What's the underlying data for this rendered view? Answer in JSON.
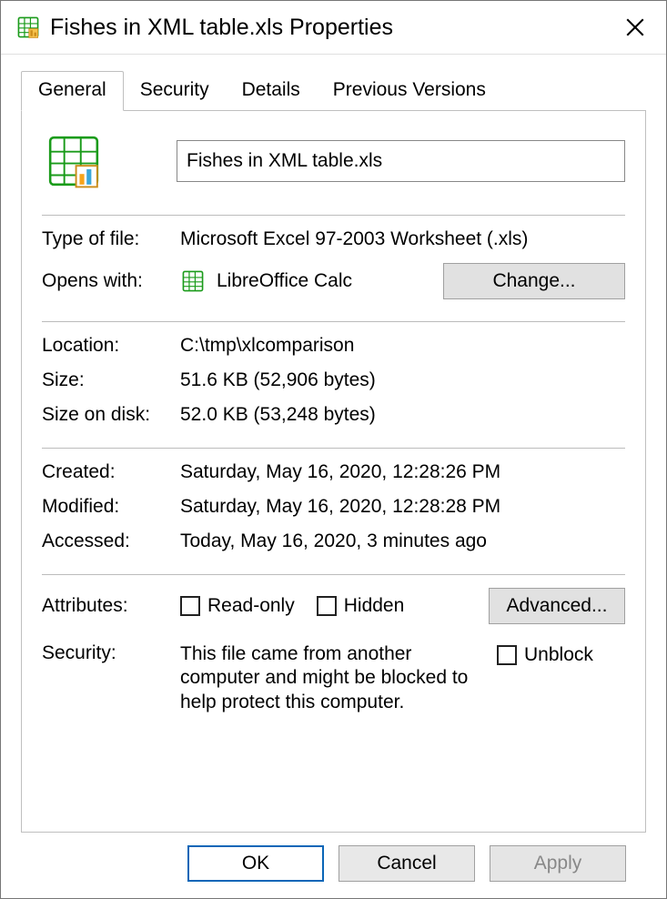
{
  "window": {
    "title": "Fishes in XML table.xls Properties"
  },
  "tabs": {
    "general": "General",
    "security": "Security",
    "details": "Details",
    "previous": "Previous Versions"
  },
  "general": {
    "filename": "Fishes in XML table.xls",
    "type_label": "Type of file:",
    "type_value": "Microsoft Excel 97-2003 Worksheet (.xls)",
    "opens_label": "Opens with:",
    "opens_value": "LibreOffice Calc",
    "change_button": "Change...",
    "location_label": "Location:",
    "location_value": "C:\\tmp\\xlcomparison",
    "size_label": "Size:",
    "size_value": "51.6 KB (52,906 bytes)",
    "size_on_disk_label": "Size on disk:",
    "size_on_disk_value": "52.0 KB (53,248 bytes)",
    "created_label": "Created:",
    "created_value": "Saturday, May 16, 2020, 12:28:26 PM",
    "modified_label": "Modified:",
    "modified_value": "Saturday, May 16, 2020, 12:28:28 PM",
    "accessed_label": "Accessed:",
    "accessed_value": "Today, May 16, 2020, 3 minutes ago",
    "attributes_label": "Attributes:",
    "readonly_label": "Read-only",
    "hidden_label": "Hidden",
    "advanced_button": "Advanced...",
    "security_label": "Security:",
    "security_text": "This file came from another computer and might be blocked to help protect this computer.",
    "unblock_label": "Unblock"
  },
  "buttons": {
    "ok": "OK",
    "cancel": "Cancel",
    "apply": "Apply"
  }
}
